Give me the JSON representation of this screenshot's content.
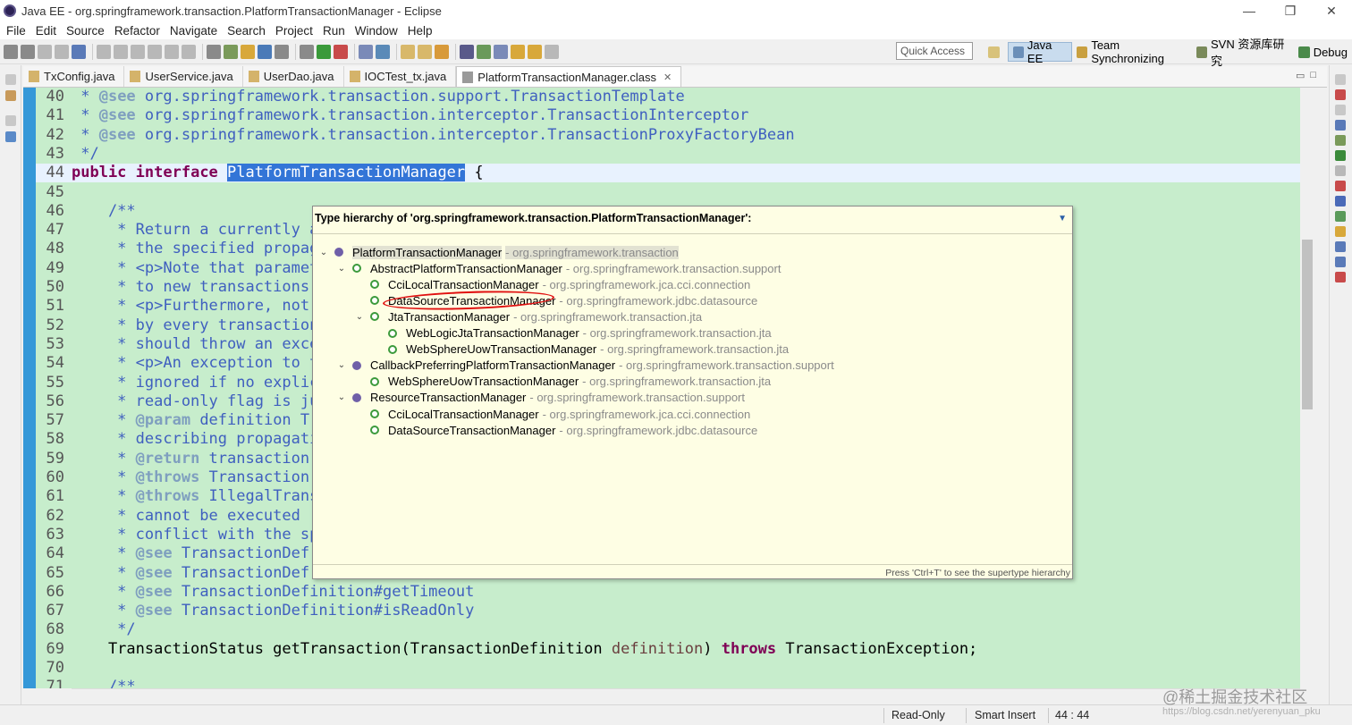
{
  "window": {
    "title": "Java EE - org.springframework.transaction.PlatformTransactionManager - Eclipse",
    "controls": [
      "—",
      "❐",
      "✕"
    ]
  },
  "menu": [
    "File",
    "Edit",
    "Source",
    "Refactor",
    "Navigate",
    "Search",
    "Project",
    "Run",
    "Window",
    "Help"
  ],
  "toolbar": {
    "quick_access_placeholder": "Quick Access",
    "perspectives": [
      "Java EE",
      "Team Synchronizing",
      "SVN 资源库研究",
      "Debug"
    ]
  },
  "tabs": [
    {
      "label": "TxConfig.java",
      "active": false
    },
    {
      "label": "UserService.java",
      "active": false
    },
    {
      "label": "UserDao.java",
      "active": false
    },
    {
      "label": "IOCTest_tx.java",
      "active": false
    },
    {
      "label": "PlatformTransactionManager.class",
      "active": true,
      "close": "✕"
    }
  ],
  "editor": {
    "lines": [
      {
        "n": "40",
        "text": " * @see org.springframework.transaction.support.TransactionTemplate"
      },
      {
        "n": "41",
        "text": " * @see org.springframework.transaction.interceptor.TransactionInterceptor"
      },
      {
        "n": "42",
        "text": " * @see org.springframework.transaction.interceptor.TransactionProxyFactoryBean"
      },
      {
        "n": "43",
        "text": " */"
      },
      {
        "n": "44",
        "text": "public interface PlatformTransactionManager {"
      },
      {
        "n": "45",
        "text": ""
      },
      {
        "n": "46",
        "text": "    /**"
      },
      {
        "n": "47",
        "text": "     * Return a currently a"
      },
      {
        "n": "48",
        "text": "     * the specified propag"
      },
      {
        "n": "49",
        "text": "     * <p>Note that paramet"
      },
      {
        "n": "50",
        "text": "     * to new transactions,"
      },
      {
        "n": "51",
        "text": "     * <p>Furthermore, not"
      },
      {
        "n": "52",
        "text": "     * by every transaction"
      },
      {
        "n": "53",
        "text": "     * should throw an exce"
      },
      {
        "n": "54",
        "text": "     * <p>An exception to t"
      },
      {
        "n": "55",
        "text": "     * ignored if no explic"
      },
      {
        "n": "56",
        "text": "     * read-only flag is ju"
      },
      {
        "n": "57",
        "text": "     * @param definition Tr"
      },
      {
        "n": "58",
        "text": "     * describing propagati"
      },
      {
        "n": "59",
        "text": "     * @return transaction"
      },
      {
        "n": "60",
        "text": "     * @throws Transaction"
      },
      {
        "n": "61",
        "text": "     * @throws IllegalTrans"
      },
      {
        "n": "62",
        "text": "     * cannot be executed"
      },
      {
        "n": "63",
        "text": "     * conflict with the sp"
      },
      {
        "n": "64",
        "text": "     * @see TransactionDef"
      },
      {
        "n": "65",
        "text": "     * @see TransactionDef"
      },
      {
        "n": "66",
        "text": "     * @see TransactionDefinition#getTimeout"
      },
      {
        "n": "67",
        "text": "     * @see TransactionDefinition#isReadOnly"
      },
      {
        "n": "68",
        "text": "     */"
      },
      {
        "n": "69",
        "text": "    TransactionStatus getTransaction(TransactionDefinition definition) throws TransactionException;"
      },
      {
        "n": "70",
        "text": ""
      },
      {
        "n": "71",
        "text": "    /**"
      }
    ]
  },
  "hierarchy": {
    "title": "Type hierarchy of 'org.springframework.transaction.PlatformTransactionManager':",
    "footer": "Press 'Ctrl+T' to see the supertype hierarchy",
    "rows": [
      {
        "name": "PlatformTransactionManager",
        "pkg": "- org.springframework.transaction",
        "depth": 0,
        "twisty": "⌄",
        "kind": "iface"
      },
      {
        "name": "AbstractPlatformTransactionManager",
        "pkg": "- org.springframework.transaction.support",
        "depth": 1,
        "twisty": "⌄",
        "kind": "class"
      },
      {
        "name": "CciLocalTransactionManager",
        "pkg": "- org.springframework.jca.cci.connection",
        "depth": 2,
        "twisty": "",
        "kind": "class"
      },
      {
        "name": "DataSourceTransactionManager",
        "pkg": "- org.springframework.jdbc.datasource",
        "depth": 2,
        "twisty": "",
        "kind": "class"
      },
      {
        "name": "JtaTransactionManager",
        "pkg": "- org.springframework.transaction.jta",
        "depth": 2,
        "twisty": "⌄",
        "kind": "class"
      },
      {
        "name": "WebLogicJtaTransactionManager",
        "pkg": "- org.springframework.transaction.jta",
        "depth": 3,
        "twisty": "",
        "kind": "class"
      },
      {
        "name": "WebSphereUowTransactionManager",
        "pkg": "- org.springframework.transaction.jta",
        "depth": 3,
        "twisty": "",
        "kind": "class"
      },
      {
        "name": "CallbackPreferringPlatformTransactionManager",
        "pkg": "- org.springframework.transaction.support",
        "depth": 1,
        "twisty": "⌄",
        "kind": "iface"
      },
      {
        "name": "WebSphereUowTransactionManager",
        "pkg": "- org.springframework.transaction.jta",
        "depth": 2,
        "twisty": "",
        "kind": "class"
      },
      {
        "name": "ResourceTransactionManager",
        "pkg": "- org.springframework.transaction.support",
        "depth": 1,
        "twisty": "⌄",
        "kind": "iface"
      },
      {
        "name": "CciLocalTransactionManager",
        "pkg": "- org.springframework.jca.cci.connection",
        "depth": 2,
        "twisty": "",
        "kind": "class"
      },
      {
        "name": "DataSourceTransactionManager",
        "pkg": "- org.springframework.jdbc.datasource",
        "depth": 2,
        "twisty": "",
        "kind": "class"
      }
    ]
  },
  "status": {
    "read_only": "Read-Only",
    "insert_mode": "Smart Insert",
    "position": "44 : 44"
  },
  "watermark": {
    "text": "@稀土掘金技术社区",
    "url": "https://blog.csdn.net/yerenyuan_pku"
  }
}
